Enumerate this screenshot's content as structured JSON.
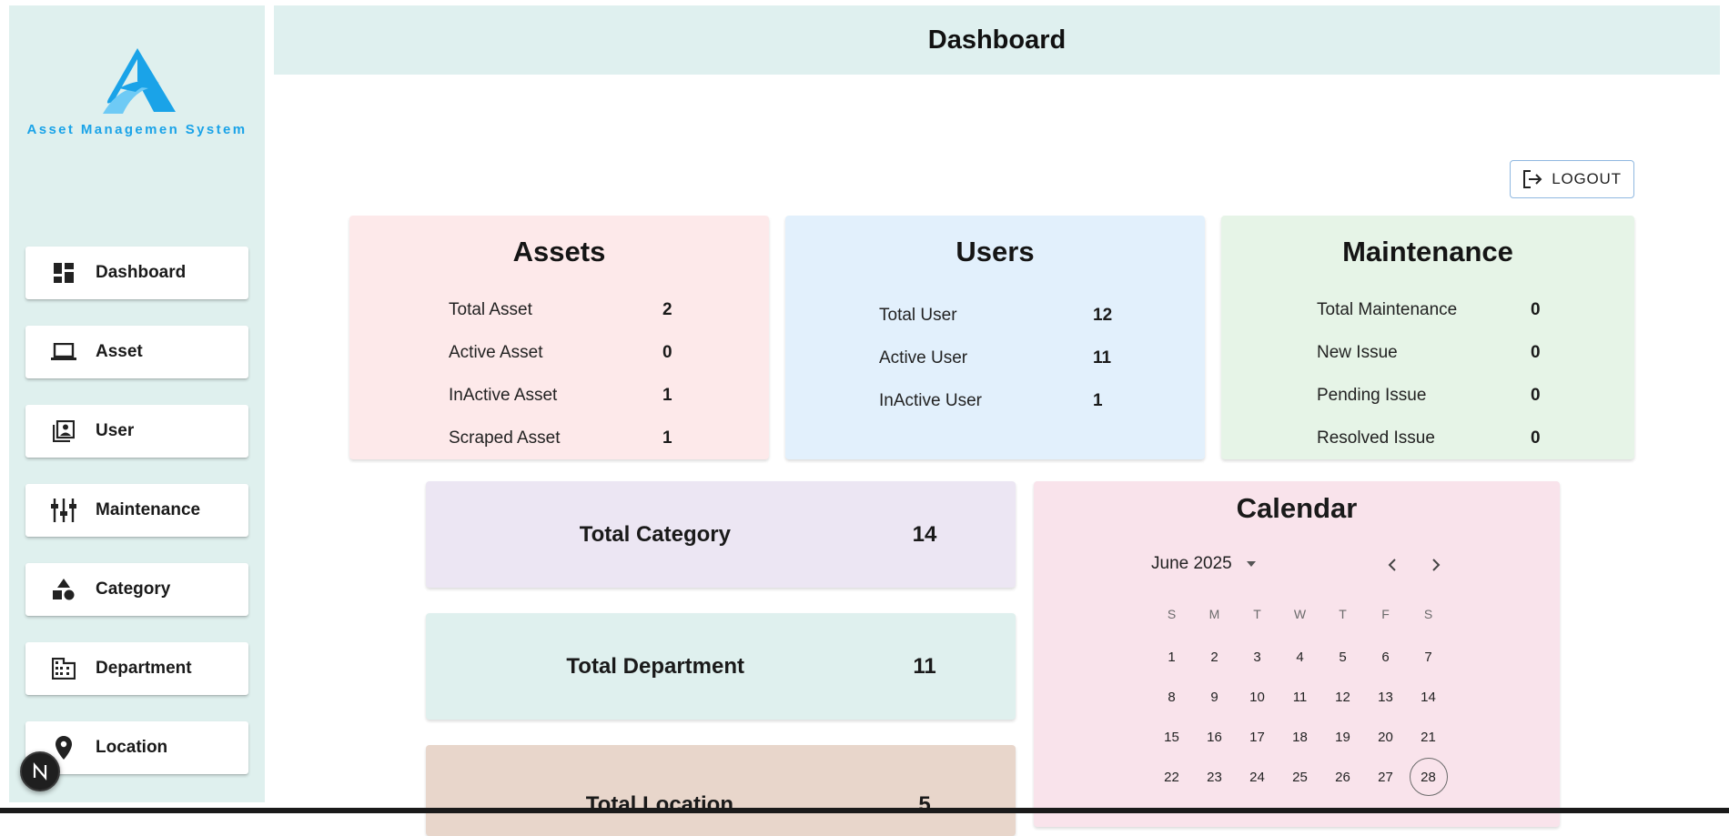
{
  "app": {
    "logo_text": "Asset Managemen System",
    "accent_color": "#1aa3e8"
  },
  "sidebar": {
    "items": [
      {
        "label": "Dashboard",
        "icon": "dashboard-icon"
      },
      {
        "label": "Asset",
        "icon": "laptop-icon"
      },
      {
        "label": "User",
        "icon": "contact-book-icon"
      },
      {
        "label": "Maintenance",
        "icon": "tune-sliders-icon"
      },
      {
        "label": "Category",
        "icon": "shapes-icon"
      },
      {
        "label": "Department",
        "icon": "building-icon"
      },
      {
        "label": "Location",
        "icon": "location-pin-icon"
      }
    ]
  },
  "header": {
    "title": "Dashboard"
  },
  "logout": {
    "label": "LOGOUT",
    "icon": "logout-icon"
  },
  "cards": {
    "assets": {
      "title": "Assets",
      "rows": [
        {
          "label": "Total Asset",
          "value": "2"
        },
        {
          "label": "Active Asset",
          "value": "0"
        },
        {
          "label": "InActive Asset",
          "value": "1"
        },
        {
          "label": "Scraped Asset",
          "value": "1"
        }
      ]
    },
    "users": {
      "title": "Users",
      "rows": [
        {
          "label": "Total User",
          "value": "12"
        },
        {
          "label": "Active User",
          "value": "11"
        },
        {
          "label": "InActive User",
          "value": "1"
        }
      ]
    },
    "maintenance": {
      "title": "Maintenance",
      "rows": [
        {
          "label": "Total Maintenance",
          "value": "0"
        },
        {
          "label": "New Issue",
          "value": "0"
        },
        {
          "label": "Pending Issue",
          "value": "0"
        },
        {
          "label": "Resolved Issue",
          "value": "0"
        }
      ]
    }
  },
  "totals": {
    "category": {
      "label": "Total Category",
      "value": "14"
    },
    "department": {
      "label": "Total Department",
      "value": "11"
    },
    "location": {
      "label": "Total Location",
      "value": "5"
    }
  },
  "calendar": {
    "title": "Calendar",
    "month_label": "June 2025",
    "weekdays": [
      "S",
      "M",
      "T",
      "W",
      "T",
      "F",
      "S"
    ],
    "weeks": [
      [
        "1",
        "2",
        "3",
        "4",
        "5",
        "6",
        "7"
      ],
      [
        "8",
        "9",
        "10",
        "11",
        "12",
        "13",
        "14"
      ],
      [
        "15",
        "16",
        "17",
        "18",
        "19",
        "20",
        "21"
      ],
      [
        "22",
        "23",
        "24",
        "25",
        "26",
        "27",
        "28"
      ]
    ],
    "selected_day": "28"
  }
}
